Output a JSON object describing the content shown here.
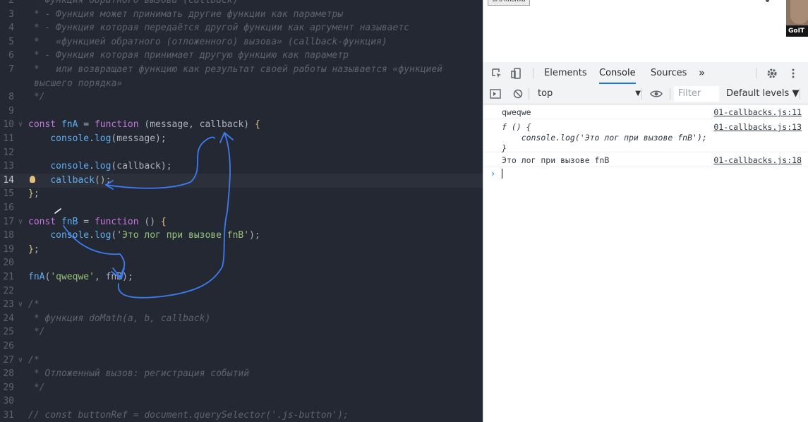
{
  "editor": {
    "lines": [
      {
        "n": "2",
        "tokens": [
          [
            "cmt",
            " * Функция обратного вызова (callback)"
          ]
        ]
      },
      {
        "n": "3",
        "tokens": [
          [
            "cmt",
            " * - Функция может принимать другие функции как параметры"
          ]
        ]
      },
      {
        "n": "4",
        "tokens": [
          [
            "cmt",
            " * - Функция которая передаётся другой функции как аргумент называетс"
          ]
        ]
      },
      {
        "n": "5",
        "tokens": [
          [
            "cmt",
            " *   «функцией обратного (отложенного) вызова» (callback-функция)"
          ]
        ]
      },
      {
        "n": "6",
        "tokens": [
          [
            "cmt",
            " * - Функция которая принимает другую функцию как параметр"
          ]
        ]
      },
      {
        "n": "7",
        "tokens": [
          [
            "cmt",
            " *   или возвращает функцию как результат своей работы называется «функцией"
          ]
        ]
      },
      {
        "n": "",
        "cont": true,
        "tokens": [
          [
            "cmt",
            "высшего порядка»"
          ]
        ]
      },
      {
        "n": "8",
        "tokens": [
          [
            "cmt",
            " */"
          ]
        ]
      },
      {
        "n": "9",
        "tokens": []
      },
      {
        "n": "10",
        "fold": "∨",
        "tokens": [
          [
            "kw",
            "const "
          ],
          [
            "def",
            "fnA"
          ],
          [
            "plain",
            " = "
          ],
          [
            "kw",
            "function "
          ],
          [
            "plain",
            "(message, callback) "
          ],
          [
            "punc",
            "{"
          ]
        ]
      },
      {
        "n": "11",
        "tokens": [
          [
            "plain",
            "    "
          ],
          [
            "obj",
            "console"
          ],
          [
            "plain",
            "."
          ],
          [
            "def",
            "log"
          ],
          [
            "plain",
            "(message);"
          ]
        ]
      },
      {
        "n": "12",
        "tokens": []
      },
      {
        "n": "13",
        "tokens": [
          [
            "plain",
            "    "
          ],
          [
            "obj",
            "console"
          ],
          [
            "plain",
            "."
          ],
          [
            "def",
            "log"
          ],
          [
            "plain",
            "(callback);"
          ]
        ]
      },
      {
        "n": "14",
        "cur": true,
        "bulb": true,
        "tokens": [
          [
            "plain",
            "    "
          ],
          [
            "def",
            "callback"
          ],
          [
            "plain",
            "();"
          ]
        ]
      },
      {
        "n": "15",
        "tokens": [
          [
            "punc",
            "}"
          ],
          [
            "plain",
            ";"
          ]
        ]
      },
      {
        "n": "16",
        "tokens": []
      },
      {
        "n": "17",
        "fold": "∨",
        "tokens": [
          [
            "kw",
            "const "
          ],
          [
            "def",
            "fnB"
          ],
          [
            "plain",
            " = "
          ],
          [
            "kw",
            "function "
          ],
          [
            "plain",
            "() "
          ],
          [
            "punc",
            "{"
          ]
        ]
      },
      {
        "n": "18",
        "tokens": [
          [
            "plain",
            "    "
          ],
          [
            "obj",
            "console"
          ],
          [
            "plain",
            "."
          ],
          [
            "def",
            "log"
          ],
          [
            "plain",
            "("
          ],
          [
            "str",
            "'Это лог при вызове fnB'"
          ],
          [
            "plain",
            ");"
          ]
        ]
      },
      {
        "n": "19",
        "tokens": [
          [
            "punc",
            "}"
          ],
          [
            "plain",
            ";"
          ]
        ]
      },
      {
        "n": "20",
        "tokens": []
      },
      {
        "n": "21",
        "tokens": [
          [
            "def",
            "fnA"
          ],
          [
            "plain",
            "("
          ],
          [
            "str",
            "'qweqwe'"
          ],
          [
            "plain",
            ", fnB);"
          ]
        ]
      },
      {
        "n": "22",
        "tokens": []
      },
      {
        "n": "23",
        "fold": "∨",
        "tokens": [
          [
            "cmt",
            "/*"
          ]
        ]
      },
      {
        "n": "24",
        "tokens": [
          [
            "cmt",
            " * функция doMath(a, b, callback)"
          ]
        ]
      },
      {
        "n": "25",
        "tokens": [
          [
            "cmt",
            " */"
          ]
        ]
      },
      {
        "n": "26",
        "tokens": []
      },
      {
        "n": "27",
        "fold": "∨",
        "tokens": [
          [
            "cmt",
            "/*"
          ]
        ]
      },
      {
        "n": "28",
        "tokens": [
          [
            "cmt",
            " * Отложенный вызов: регистрация событий"
          ]
        ]
      },
      {
        "n": "29",
        "tokens": [
          [
            "cmt",
            " */"
          ]
        ]
      },
      {
        "n": "30",
        "tokens": []
      },
      {
        "n": "31",
        "tokens": [
          [
            "cmt",
            "// const buttonRef = document.querySelector('.js-button');"
          ]
        ]
      }
    ]
  },
  "browser": {
    "bookmark_label": "ого кнопка",
    "webcam_label": "GoIT"
  },
  "devtools": {
    "tabs": [
      "Elements",
      "Console",
      "Sources"
    ],
    "active_tab": "Console",
    "more_tabs_icon": "»",
    "context": "top",
    "filter_placeholder": "Filter",
    "levels_label": "Default levels ▼",
    "messages": [
      {
        "text": "qweqwe",
        "source": "01-callbacks.js:11"
      },
      {
        "text": "f () {\n    console.log('Это лог при вызове fnB');\n}",
        "source": "01-callbacks.js:13"
      },
      {
        "text": "Это лог при вызове fnB",
        "source": "01-callbacks.js:18"
      }
    ],
    "prompt_symbol": "›"
  },
  "colors": {
    "editor_bg": "#232833",
    "annotation": "#3d7cf0",
    "devtools_accent": "#1a73e8"
  }
}
